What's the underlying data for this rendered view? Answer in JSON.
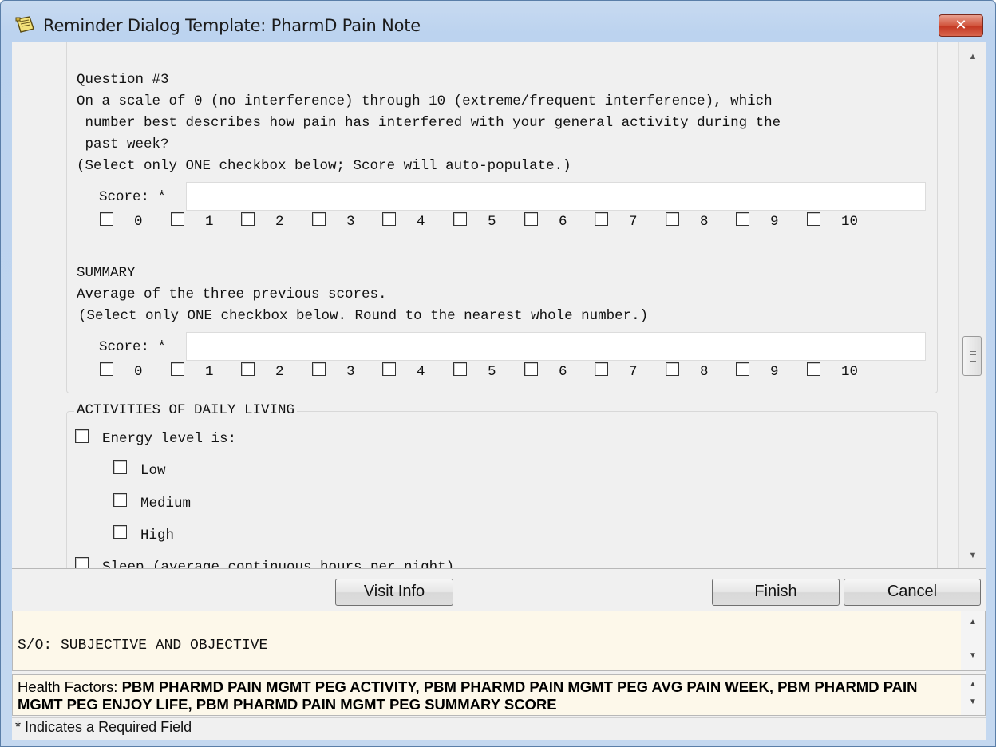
{
  "window": {
    "title": "Reminder Dialog Template: PharmD Pain Note",
    "close_glyph": "✕"
  },
  "question3": {
    "heading": "Question #3",
    "line1": "On a scale of 0 (no interference) through 10 (extreme/frequent interference), which",
    "line2": " number best describes how pain has interfered with your general activity during the",
    "line3": " past week?",
    "instruction": "(Select only ONE checkbox below; Score will auto-populate.)",
    "score_label": "Score: *",
    "score_value": "",
    "options": [
      "0",
      "1",
      "2",
      "3",
      "4",
      "5",
      "6",
      "7",
      "8",
      "9",
      "10"
    ]
  },
  "summary": {
    "heading": "SUMMARY",
    "line1": "Average of the three previous scores.",
    "instruction": "(Select only ONE checkbox below. Round to the nearest whole number.)",
    "score_label": "Score: *",
    "score_value": "",
    "options": [
      "0",
      "1",
      "2",
      "3",
      "4",
      "5",
      "6",
      "7",
      "8",
      "9",
      "10"
    ]
  },
  "adl": {
    "legend": "ACTIVITIES OF DAILY LIVING",
    "energy_label": "Energy level is:",
    "energy_options": [
      "Low",
      "Medium",
      "High"
    ],
    "sleep_label": "Sleep (average continuous hours per night)"
  },
  "buttons": {
    "visit_info": "Visit Info",
    "finish": "Finish",
    "cancel": "Cancel"
  },
  "preview": {
    "text": "S/O: SUBJECTIVE AND OBJECTIVE"
  },
  "health_factors": {
    "label": "Health Factors: ",
    "value": "PBM PHARMD PAIN MGMT PEG ACTIVITY, PBM PHARMD PAIN MGMT PEG AVG PAIN WEEK, PBM PHARMD PAIN MGMT PEG ENJOY LIFE, PBM PHARMD PAIN MGMT PEG SUMMARY SCORE"
  },
  "status": {
    "text": "* Indicates a Required Field"
  },
  "icons": {
    "scroll_up": "▲",
    "scroll_down": "▼"
  }
}
